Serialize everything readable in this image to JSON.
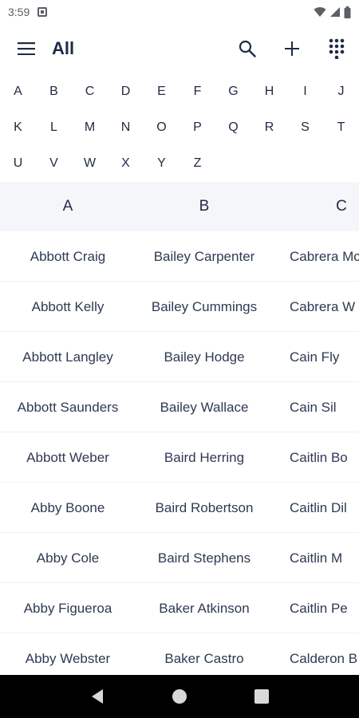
{
  "status_bar": {
    "time": "3:59"
  },
  "app_bar": {
    "title": "All"
  },
  "alphabet": [
    "A",
    "B",
    "C",
    "D",
    "E",
    "F",
    "G",
    "H",
    "I",
    "J",
    "K",
    "L",
    "M",
    "N",
    "O",
    "P",
    "Q",
    "R",
    "S",
    "T",
    "U",
    "V",
    "W",
    "X",
    "Y",
    "Z"
  ],
  "columns": [
    "A",
    "B",
    "C"
  ],
  "rows": [
    [
      "Abbott Craig",
      "Bailey Carpenter",
      "Cabrera Mc"
    ],
    [
      "Abbott Kelly",
      "Bailey Cummings",
      "Cabrera W"
    ],
    [
      "Abbott Langley",
      "Bailey Hodge",
      "Cain Fly"
    ],
    [
      "Abbott Saunders",
      "Bailey Wallace",
      "Cain Sil"
    ],
    [
      "Abbott Weber",
      "Baird Herring",
      "Caitlin Bo"
    ],
    [
      "Abby Boone",
      "Baird Robertson",
      "Caitlin Dil"
    ],
    [
      "Abby Cole",
      "Baird Stephens",
      "Caitlin M"
    ],
    [
      "Abby Figueroa",
      "Baker Atkinson",
      "Caitlin Pe"
    ],
    [
      "Abby Webster",
      "Baker Castro",
      "Calderon B"
    ]
  ],
  "icons": {
    "menu": "menu-icon",
    "search": "search-icon",
    "add": "add-icon",
    "dialpad": "dialpad-icon",
    "back": "back-icon",
    "home": "home-icon",
    "recents": "recents-icon"
  },
  "colors": {
    "text": "#1f2a44",
    "header_bg": "#f4f6fa",
    "nav_bg": "#000000"
  }
}
